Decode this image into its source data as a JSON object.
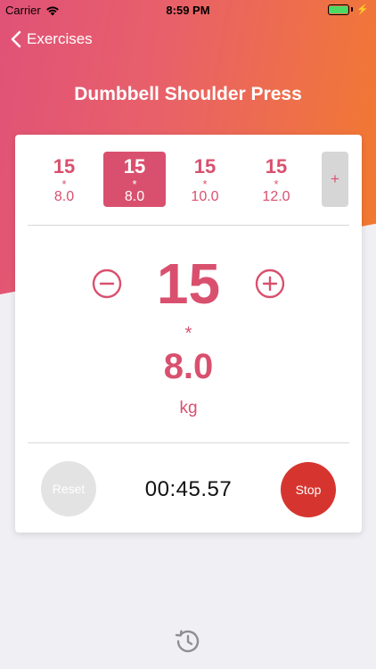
{
  "status_bar": {
    "carrier": "Carrier",
    "time": "8:59 PM",
    "battery_level": 1.0
  },
  "nav": {
    "back_label": "Exercises"
  },
  "exercise": {
    "title": "Dumbbell Shoulder Press"
  },
  "sets": [
    {
      "reps": "15",
      "separator": "*",
      "weight": "8.0",
      "selected": false
    },
    {
      "reps": "15",
      "separator": "*",
      "weight": "8.0",
      "selected": true
    },
    {
      "reps": "15",
      "separator": "*",
      "weight": "10.0",
      "selected": false
    },
    {
      "reps": "15",
      "separator": "*",
      "weight": "12.0",
      "selected": false
    }
  ],
  "add_set_label": "+",
  "current": {
    "reps": "15",
    "separator": "*",
    "weight": "8.0",
    "unit": "kg"
  },
  "timer": {
    "reset_label": "Reset",
    "elapsed": "00:45.57",
    "stop_label": "Stop"
  },
  "colors": {
    "accent": "#d9506e",
    "gradient_start": "#e05277",
    "gradient_end": "#f27a2c",
    "stop": "#d6352f",
    "reset": "#e3e3e3"
  },
  "icons": {
    "back": "chevron-left-icon",
    "decrement": "minus-circle-icon",
    "increment": "plus-circle-icon",
    "history": "history-icon",
    "wifi": "wifi-icon",
    "battery": "battery-icon"
  }
}
